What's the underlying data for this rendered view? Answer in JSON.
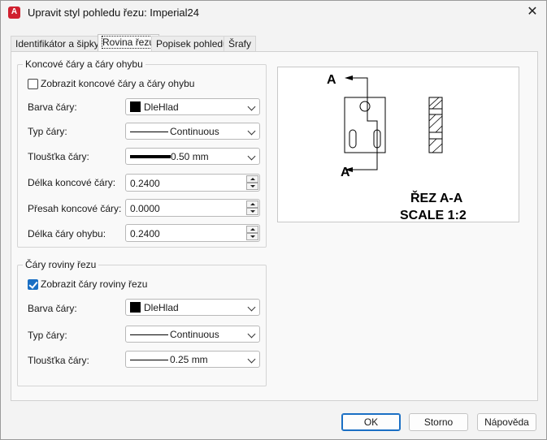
{
  "window": {
    "title": "Upravit styl pohledu řezu: Imperial24",
    "close_glyph": "✕"
  },
  "tabs": [
    {
      "label": "Identifikátor a šipky",
      "active": false
    },
    {
      "label": "Rovina řezu",
      "active": true
    },
    {
      "label": "Popisek pohledu",
      "active": false
    },
    {
      "label": "Šrafy",
      "active": false
    }
  ],
  "end_lines_group": {
    "title": "Koncové čáry a čáry ohybu",
    "show_checkbox": {
      "label": "Zobrazit koncové čáry a čáry ohybu",
      "checked": false
    },
    "line_color": {
      "label": "Barva čáry:",
      "value": "DleHlad",
      "swatch": "#000000"
    },
    "line_type": {
      "label": "Typ čáry:",
      "value": "Continuous"
    },
    "line_weight": {
      "label": "Tloušťka čáry:",
      "value": "0.50 mm"
    },
    "end_line_length": {
      "label": "Délka koncové čáry:",
      "value": "0.2400"
    },
    "end_line_overshoot": {
      "label": "Přesah koncové čáry:",
      "value": "0.0000"
    },
    "bend_line_length": {
      "label": "Délka čáry ohybu:",
      "value": "0.2400"
    }
  },
  "plane_lines_group": {
    "title": "Čáry roviny řezu",
    "show_checkbox": {
      "label": "Zobrazit čáry roviny řezu",
      "checked": true
    },
    "line_color": {
      "label": "Barva čáry:",
      "value": "DleHlad",
      "swatch": "#000000"
    },
    "line_type": {
      "label": "Typ čáry:",
      "value": "Continuous"
    },
    "line_weight": {
      "label": "Tloušťka čáry:",
      "value": "0.25 mm"
    }
  },
  "preview": {
    "label_top": "A",
    "label_bottom": "A",
    "caption_line1": "ŘEZ A-A",
    "caption_line2": "SCALE 1:2"
  },
  "buttons": {
    "ok": "OK",
    "cancel": "Storno",
    "help": "Nápověda"
  },
  "colors": {
    "accent": "#1a6fc4",
    "app_icon": "#d0202f"
  }
}
